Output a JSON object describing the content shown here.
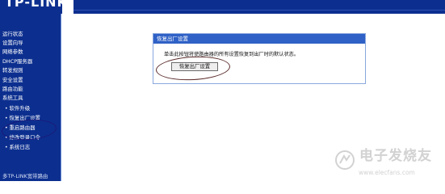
{
  "header": {
    "logo_text": "TP-LINK"
  },
  "sidebar": {
    "items": [
      {
        "label": "运行状态",
        "sub": false
      },
      {
        "label": "设置向导",
        "sub": false
      },
      {
        "label": "网络参数",
        "sub": false
      },
      {
        "label": "DHCP服务器",
        "sub": false
      },
      {
        "label": "转发规则",
        "sub": false
      },
      {
        "label": "安全设置",
        "sub": false
      },
      {
        "label": "路由功能",
        "sub": false
      },
      {
        "label": "系统工具",
        "sub": false
      },
      {
        "label": "软件升级",
        "sub": true
      },
      {
        "label": "恢复出厂设置",
        "sub": true
      },
      {
        "label": "重启路由器",
        "sub": true
      },
      {
        "label": "修改登录口令",
        "sub": true
      },
      {
        "label": "系统日志",
        "sub": true
      },
      {
        "label": "多TP-LINK宽带路由",
        "sub": false
      }
    ]
  },
  "panel": {
    "title": "恢复出厂设置",
    "message": "单击此按钮将使路由器的所有设置恢复到出厂时的默认状态。",
    "button_label": "恢复出厂设置"
  },
  "watermark": {
    "text": "电子发烧友",
    "url": "www.elecfans.com"
  }
}
